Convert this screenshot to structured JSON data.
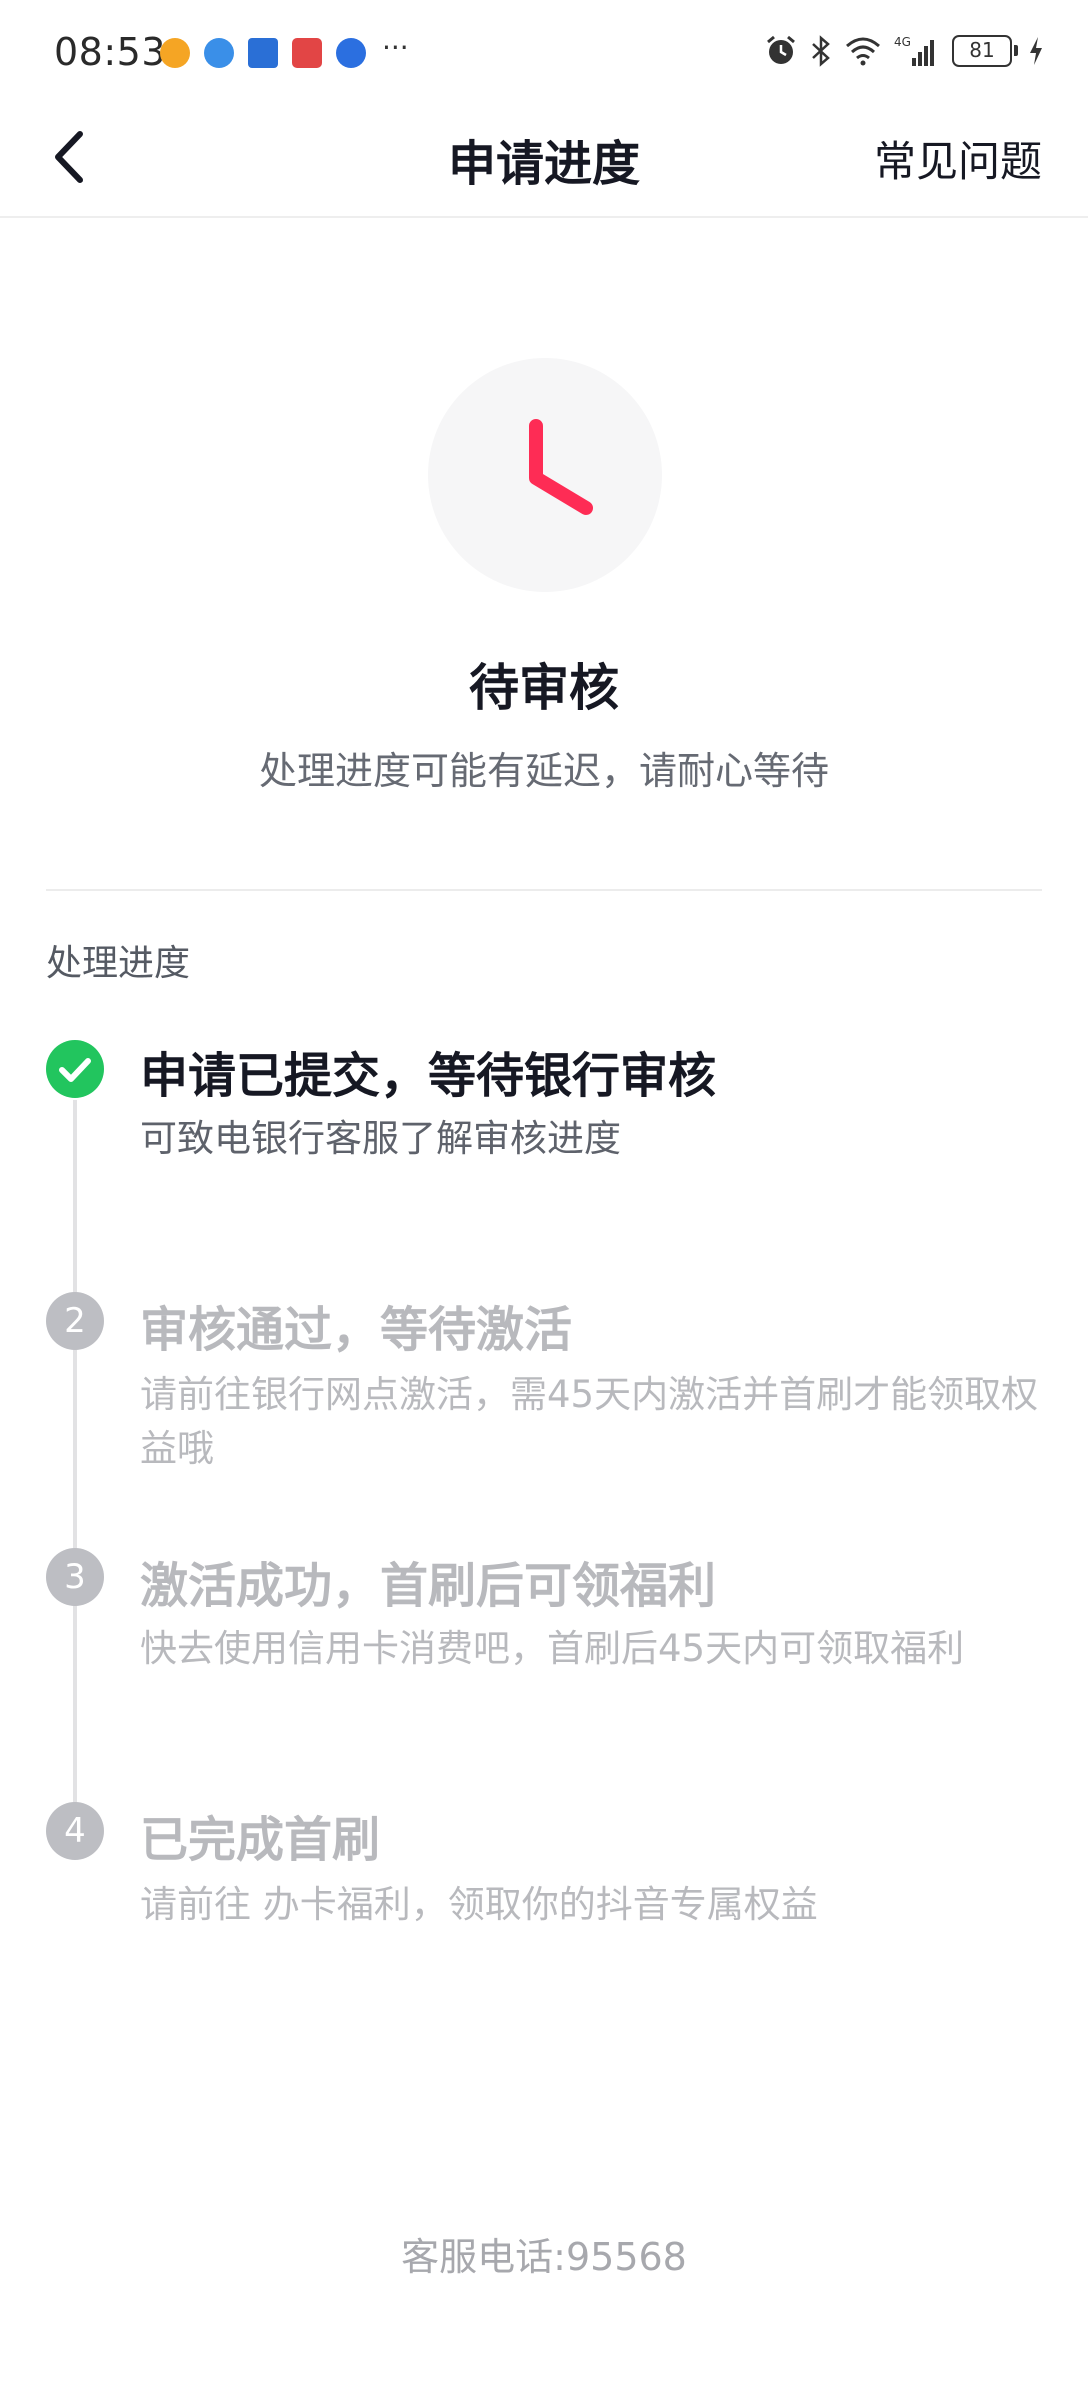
{
  "status_bar": {
    "time": "08:53",
    "notification_icons": [
      "weibo-icon",
      "globe-icon",
      "app-icon",
      "book-icon",
      "u-app-icon"
    ],
    "more": "···",
    "network": "4G",
    "battery": "81"
  },
  "nav": {
    "title": "申请进度",
    "faq_label": "常见问题"
  },
  "status": {
    "icon": "clock-icon",
    "accent_color": "#fe2c55",
    "title": "待审核",
    "description": "处理进度可能有延迟，请耐心等待"
  },
  "progress": {
    "section_title": "处理进度",
    "steps": [
      {
        "number": "",
        "state": "done",
        "title": "申请已提交，等待银行审核",
        "description": "可致电银行客服了解审核进度"
      },
      {
        "number": "2",
        "state": "pending",
        "title": "审核通过，等待激活",
        "description": "请前往银行网点激活，需45天内激活并首刷才能领取权益哦"
      },
      {
        "number": "3",
        "state": "pending",
        "title": "激活成功，首刷后可领福利",
        "description": "快去使用信用卡消费吧，首刷后45天内可领取福利"
      },
      {
        "number": "4",
        "state": "pending",
        "title": "已完成首刷",
        "description": "请前往 办卡福利，领取你的抖音专属权益"
      }
    ]
  },
  "footer": {
    "hotline": "客服电话:95568"
  },
  "colors": {
    "done_green": "#22c55e",
    "pending_gray": "#bdbec3"
  }
}
